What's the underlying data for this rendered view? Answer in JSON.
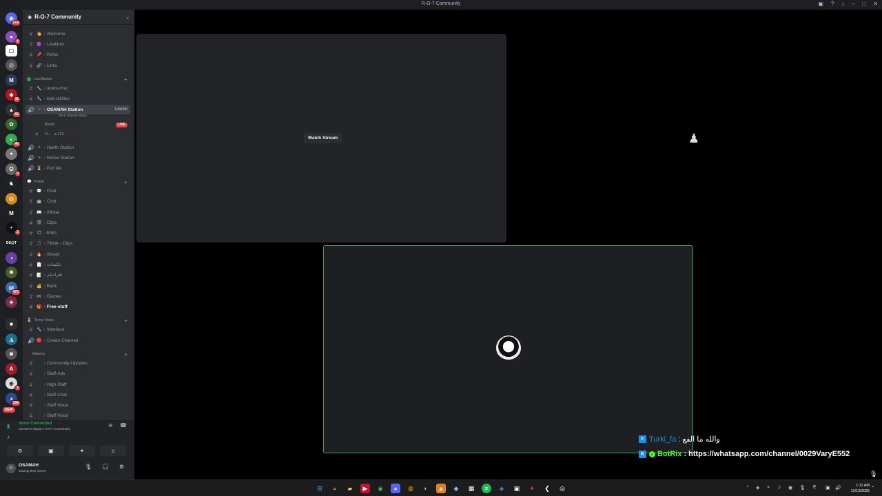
{
  "window": {
    "title": "R-O-7 Community"
  },
  "titlebar_icons": [
    "inbox-icon",
    "help-icon",
    "download-icon",
    "minimize-icon",
    "maximize-icon",
    "close-icon"
  ],
  "rail": {
    "badges": [
      "219",
      "8",
      "11",
      "82",
      "46",
      "9",
      "2",
      "473",
      "158",
      "1"
    ],
    "partial_label": "DS@T",
    "new_label": "NEW"
  },
  "server": {
    "name": "R-O-7 Community"
  },
  "channels_top": [
    {
      "label": "Welcome",
      "emoji": "👋"
    },
    {
      "label": "LiveNow",
      "emoji": "🟣"
    },
    {
      "label": "Roles",
      "emoji": "📌"
    },
    {
      "label": "Links",
      "emoji": "🔗"
    }
  ],
  "cat_livestation": "LiveStation",
  "livestation_channels": [
    {
      "label": "mods-chat"
    },
    {
      "label": "kick-utilities"
    }
  ],
  "active_voice": {
    "label": "OSAMAH Station",
    "time": "3:54:50",
    "status": "Set a channel status"
  },
  "voice_members": [
    {
      "name": "Bader",
      "live": "LIVE"
    },
    {
      "name": "O...",
      "extra": "219"
    }
  ],
  "voice_channels": [
    {
      "label": "Harith Station"
    },
    {
      "label": "Rellax Station"
    },
    {
      "label": "Pull Me"
    }
  ],
  "cat_public": "Public",
  "public_channels": [
    {
      "label": "Chat",
      "emoji": "💬"
    },
    {
      "label": "Cmd",
      "emoji": "🤖"
    },
    {
      "label": "Athkar",
      "emoji": "📖"
    },
    {
      "label": "Clips",
      "emoji": "🎬"
    },
    {
      "label": "Edits",
      "emoji": "🎞"
    },
    {
      "label": "Tiktok - Clips",
      "emoji": "🎵"
    },
    {
      "label": "Streak",
      "emoji": "🔥"
    },
    {
      "label": "تكليمات",
      "emoji": "📄"
    },
    {
      "label": "اقراحكم",
      "emoji": "📝"
    },
    {
      "label": "Bank",
      "emoji": "💰"
    },
    {
      "label": "Games",
      "emoji": "🎮"
    },
    {
      "label": "Free-stuff",
      "emoji": "🎁"
    }
  ],
  "cat_tempvoice": "Temp Voice",
  "tempvoice_channels": [
    {
      "label": "Interface"
    },
    {
      "label": "Create Channel"
    }
  ],
  "cat_admins": "Admins",
  "admin_channels": [
    {
      "label": "Community-Updates"
    },
    {
      "label": "Staff-Ads"
    },
    {
      "label": "High-Staff"
    },
    {
      "label": "Staff-Chat"
    },
    {
      "label": "Staff Voice"
    },
    {
      "label": "Staff Voice"
    }
  ],
  "voice_panel": {
    "status": "Voice Connected",
    "location": "OSAMAH Station / R-O-7 Community"
  },
  "user_panel": {
    "name": "OSAMAH",
    "status": "Sharing their screen",
    "avatar_initial": "O"
  },
  "stage": {
    "watch_label": "Watch Stream"
  },
  "chat_overlay": [
    {
      "user": "Turki_fa",
      "separator": ":",
      "message": "والله ما الفع",
      "color": "#1e8fe8"
    },
    {
      "user": "BotRix",
      "separator": ":",
      "message": "https://whatsapp.com/channel/0029VaryE552",
      "color": "#53fc18"
    }
  ],
  "taskbar": {
    "time": "1:11 AM",
    "date": "11/13/2025"
  }
}
